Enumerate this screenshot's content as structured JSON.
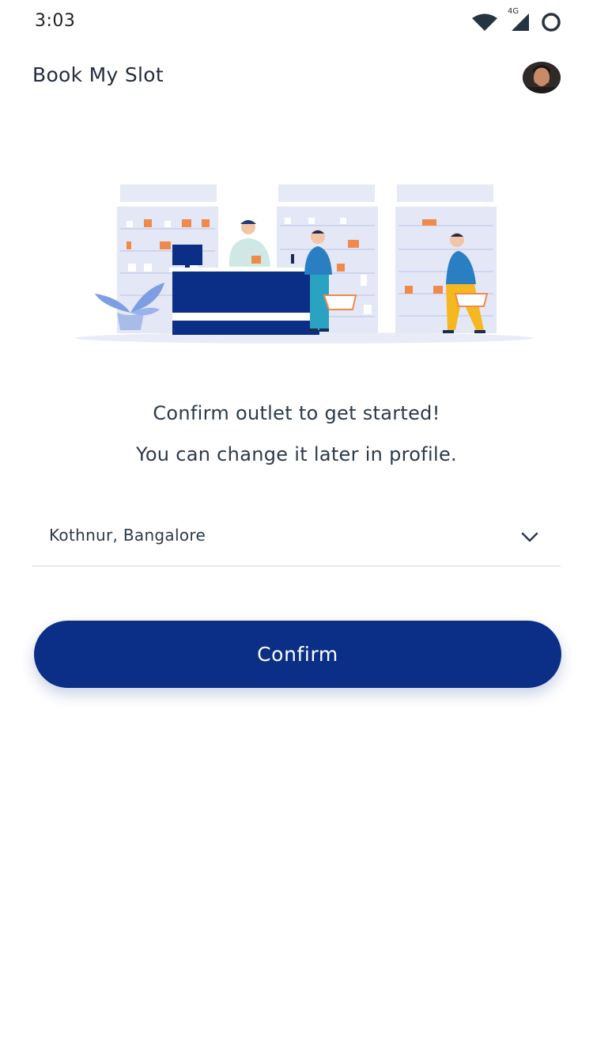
{
  "status_bar": {
    "time": "3:03",
    "network_label": "4G",
    "icons": [
      "wifi-icon",
      "cellular-signal-icon",
      "data-saver-icon"
    ]
  },
  "header": {
    "title": "Book My Slot",
    "avatar": "profile-avatar"
  },
  "illustration": {
    "name": "pharmacy-store-illustration"
  },
  "prompt": {
    "line1": "Confirm outlet to get started!",
    "line2": "You can change it later in profile."
  },
  "outlet": {
    "selected": "Kothnur, Bangalore",
    "icon": "chevron-down-icon"
  },
  "confirm": {
    "label": "Confirm"
  },
  "colors": {
    "primary": "#0b2f86",
    "shelf": "#dfe3f5",
    "accent_orange": "#f08a4b",
    "accent_teal": "#2aa3c2",
    "accent_yellow": "#f5b820"
  }
}
